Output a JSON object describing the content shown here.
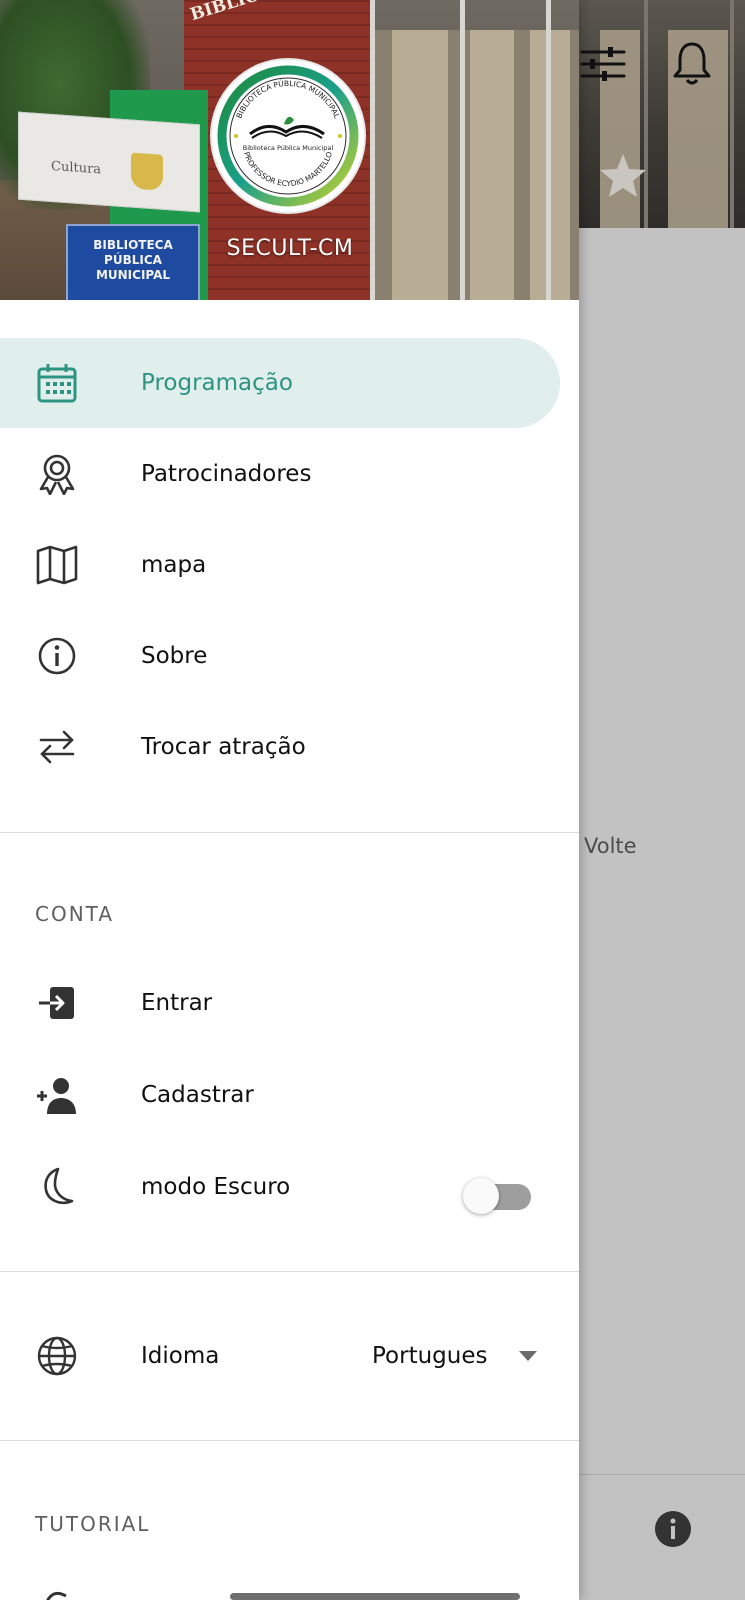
{
  "background_app": {
    "partial_text": "Volte"
  },
  "drawer": {
    "header": {
      "title": "SECULT-CM",
      "logo_text_top": "BIBLIOTECA PÚBLICA MUNICIPAL",
      "logo_text_center": "Biblioteca Pública Municipal",
      "logo_text_bottom": "PROFESSOR ECYDIO MARTELLO",
      "building_letters": "BIBLIOTECA MU... PROF. ECYDIO MARTELLO",
      "sign_brand": "Cultura",
      "blue_sign": "BIBLIOTECA\nPÚBLICA\nMUNICIPAL"
    },
    "menu": [
      {
        "label": "Programação",
        "icon": "calendar-icon",
        "active": true
      },
      {
        "label": "Patrocinadores",
        "icon": "award-ribbon-icon",
        "active": false
      },
      {
        "label": "mapa",
        "icon": "map-icon",
        "active": false
      },
      {
        "label": "Sobre",
        "icon": "info-icon",
        "active": false
      },
      {
        "label": "Trocar atração",
        "icon": "swap-arrows-icon",
        "active": false
      }
    ],
    "account": {
      "heading": "CONTA",
      "items": [
        {
          "label": "Entrar",
          "icon": "login-icon"
        },
        {
          "label": "Cadastrar",
          "icon": "add-person-icon"
        },
        {
          "label": "modo Escuro",
          "icon": "moon-icon",
          "toggle_on": false
        }
      ]
    },
    "language": {
      "label": "Idioma",
      "icon": "globe-icon",
      "selected": "Portugues"
    },
    "tutorial": {
      "heading": "TUTORIAL"
    }
  },
  "colors": {
    "accent": "#2e9482",
    "active_bg": "#e0eeec",
    "scrim": "#c2c2c2"
  }
}
